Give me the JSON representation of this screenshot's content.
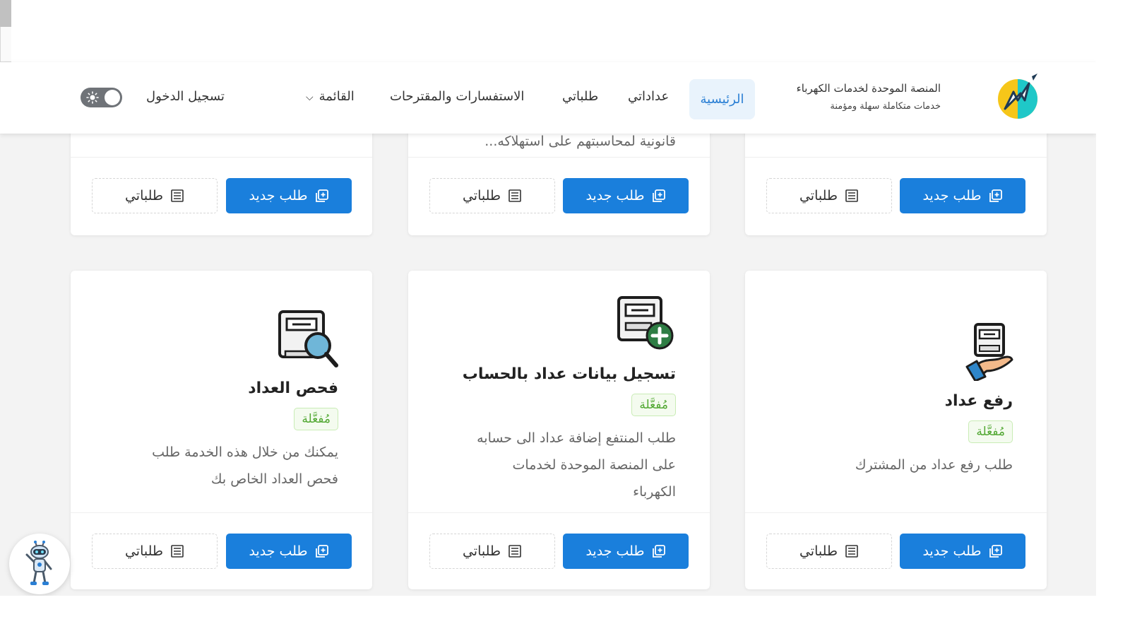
{
  "brand": {
    "title": "المنصة الموحدة لخدمات الكهرباء",
    "subtitle": "خدمات متكاملة سهلة ومؤمنة"
  },
  "nav": {
    "home": "الرئيسية",
    "meters": "عداداتي",
    "requests": "طلباتي",
    "inquiries": "الاستفسارات والمقترحات",
    "menu": "القائمة",
    "login": "تسجيل الدخول"
  },
  "buttons": {
    "new_request": "طلب جديد",
    "my_requests": "طلباتي"
  },
  "top_row": {
    "middle_desc_tail": "قانونية لمحاسبتهم على استهلاكه..."
  },
  "cards": [
    {
      "title": "رفع عداد",
      "status": "مُفعَّلة",
      "description": "طلب رفع عداد من المشترك"
    },
    {
      "title": "تسجيل بيانات عداد بالحساب",
      "status": "مُفعَّلة",
      "description_lines": [
        "طلب المنتفع إضافة عداد الى حسابه",
        "على المنصة الموحدة لخدمات",
        "الكهرباء"
      ]
    },
    {
      "title": "فحص العداد",
      "status": "مُفعَّلة",
      "description_lines": [
        "يمكنك من خلال هذه الخدمة طلب",
        "فحص العداد الخاص بك"
      ]
    }
  ],
  "colors": {
    "primary": "#1a7fdc",
    "active_nav_bg": "#e9f3fc",
    "badge_green": "#52a833",
    "page_bg": "#f3f3f3"
  },
  "icons": {
    "new_request": "plus-square-icon",
    "my_requests": "list-icon",
    "menu": "chevron-down-icon",
    "toggle": "sun-icon"
  }
}
